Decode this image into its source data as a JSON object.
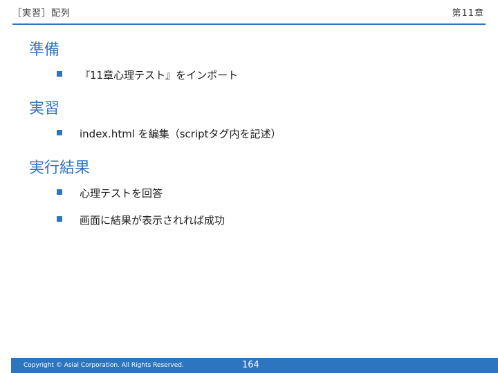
{
  "header": {
    "topic": "［実習］配列",
    "chapter": "第11章"
  },
  "sections": [
    {
      "title": "準備",
      "bullets": [
        "『11章心理テスト』をインポート"
      ]
    },
    {
      "title": "実習",
      "bullets": [
        "index.html を編集（scriptタグ内を記述）"
      ]
    },
    {
      "title": "実行結果",
      "bullets": [
        "心理テストを回答",
        "画面に結果が表示されれば成功"
      ]
    }
  ],
  "footer": {
    "copyright": "Copyright © Asial Corporation. All Rights Reserved.",
    "page_number": "164"
  },
  "colors": {
    "accent": "#2e75c0",
    "text": "#1a1a1a"
  }
}
